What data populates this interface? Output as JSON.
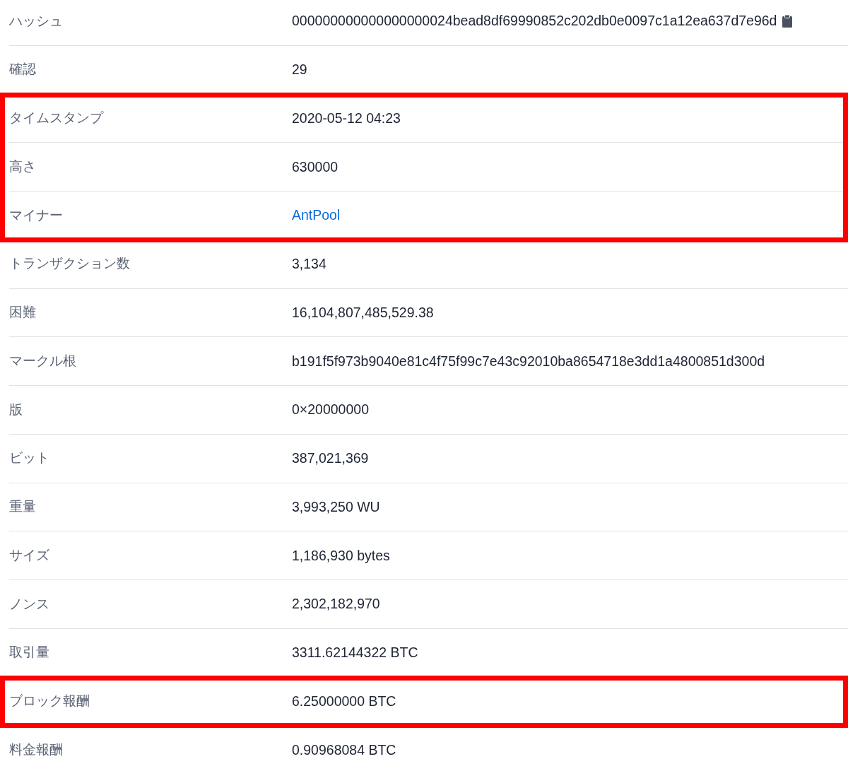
{
  "rows": [
    {
      "label": "ハッシュ",
      "value": "000000000000000000024bead8df69990852c202db0e0097c1a12ea637d7e96d",
      "kind": "copy",
      "highlighted": false
    },
    {
      "label": "確認",
      "value": "29",
      "kind": "text",
      "highlighted": false
    },
    {
      "label": "タイムスタンプ",
      "value": "2020-05-12 04:23",
      "kind": "text",
      "highlighted": true
    },
    {
      "label": "高さ",
      "value": "630000",
      "kind": "text",
      "highlighted": true
    },
    {
      "label": "マイナー",
      "value": "AntPool",
      "kind": "link",
      "highlighted": true
    },
    {
      "label": "トランザクション数",
      "value": "3,134",
      "kind": "text",
      "highlighted": false
    },
    {
      "label": "困難",
      "value": "16,104,807,485,529.38",
      "kind": "text",
      "highlighted": false
    },
    {
      "label": "マークル根",
      "value": "b191f5f973b9040e81c4f75f99c7e43c92010ba8654718e3dd1a4800851d300d",
      "kind": "text",
      "highlighted": false
    },
    {
      "label": "版",
      "value": "0×20000000",
      "kind": "text",
      "highlighted": false
    },
    {
      "label": "ビット",
      "value": "387,021,369",
      "kind": "text",
      "highlighted": false
    },
    {
      "label": "重量",
      "value": "3,993,250 WU",
      "kind": "text",
      "highlighted": false
    },
    {
      "label": "サイズ",
      "value": "1,186,930 bytes",
      "kind": "text",
      "highlighted": false
    },
    {
      "label": "ノンス",
      "value": "2,302,182,970",
      "kind": "text",
      "highlighted": false
    },
    {
      "label": "取引量",
      "value": "3311.62144322 BTC",
      "kind": "text",
      "highlighted": false
    },
    {
      "label": "ブロック報酬",
      "value": "6.25000000 BTC",
      "kind": "text",
      "highlighted": true
    },
    {
      "label": "料金報酬",
      "value": "0.90968084 BTC",
      "kind": "text",
      "highlighted": false
    }
  ]
}
